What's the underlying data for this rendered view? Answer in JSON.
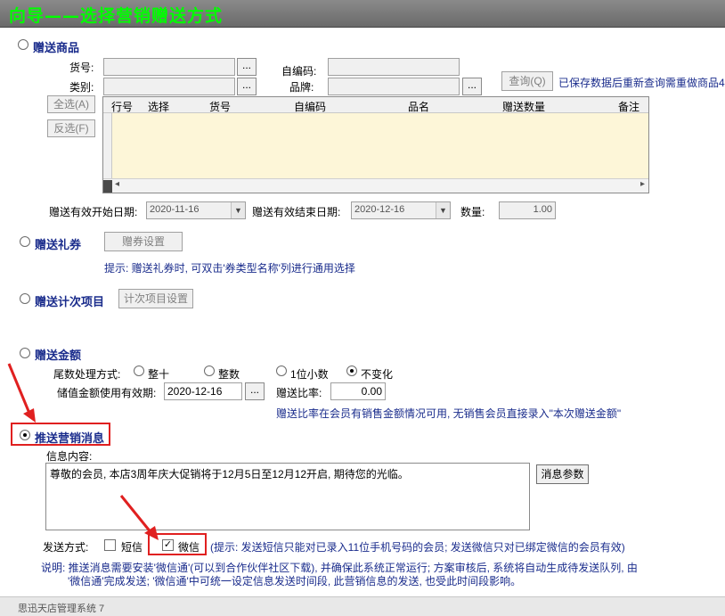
{
  "title": "向导——选择营销赠送方式",
  "gift_goods": {
    "label": "赠送商品",
    "huohao_label": "货号:",
    "leibie_label": "类别:",
    "zibianma_label": "自编码:",
    "pinpai_label": "品牌:",
    "ellipsis": "...",
    "query_button": "查询(Q)",
    "query_hint": "已保存数据后重新查询需重做商品4",
    "select_all": "全选(A)",
    "invert": "反选(F)",
    "columns": [
      "行号",
      "选择",
      "货号",
      "自编码",
      "品名",
      "赠送数量",
      "备注"
    ],
    "start_date_label": "赠送有效开始日期:",
    "start_date": "2020-11-16",
    "end_date_label": "赠送有效结束日期:",
    "end_date": "2020-12-16",
    "qty_label": "数量:",
    "qty": "1.00"
  },
  "gift_coupon": {
    "label": "赠送礼券",
    "settings_button": "赠券设置",
    "hint": "提示: 赠送礼券时, 可双击'券类型名称'列进行通用选择"
  },
  "gift_count": {
    "label": "赠送计次项目",
    "settings_button": "计次项目设置"
  },
  "gift_amount": {
    "label": "赠送金额",
    "rounding_label": "尾数处理方式:",
    "rounding_options": [
      "整十",
      "整数",
      "1位小数",
      "不变化"
    ],
    "rounding_selected": "不变化",
    "expiry_label": "储值金额使用有效期:",
    "expiry_value": "2020-12-16",
    "ratio_label": "赠送比率:",
    "ratio_value": "0.00",
    "ratio_hint": "赠送比率在会员有销售金额情况可用, 无销售会员直接录入\"本次赠送金额\""
  },
  "push_message": {
    "label": "推送营销消息",
    "content_label": "信息内容:",
    "content": "尊敬的会员, 本店3周年庆大促销将于12月5日至12月12开启, 期待您的光临。",
    "params_button": "消息参数",
    "send_label": "发送方式:",
    "sms_label": "短信",
    "sms_checked": false,
    "wechat_label": "微信",
    "wechat_checked": true,
    "send_hint": "(提示: 发送短信只能对已录入11位手机号码的会员; 发送微信只对已绑定微信的会员有效)",
    "note_line1": "说明: 推送消息需要安装'微信通'(可以到合作伙伴社区下载), 并确保此系统正常运行; 方案审核后, 系统将自动生成待发送队列, 由",
    "note_line2": "'微信通'完成发送; '微信通'中可统一设定信息发送时间段, 此营销信息的发送, 也受此时间段影响。"
  },
  "bottom": {
    "taskbar_text": "思迅天店管理系统 7"
  },
  "colors": {
    "title_text": "#00ff00",
    "label_blue": "#1a2c8c",
    "highlight_red": "#e02020",
    "grid_body": "#fdf6d8"
  }
}
